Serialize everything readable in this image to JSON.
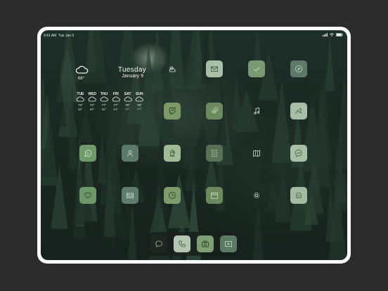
{
  "status_bar": {
    "time": "9:41 AM",
    "date": "Tue Jan 9"
  },
  "weather": {
    "icon": "cloud-icon",
    "current_temp": "68°",
    "day": "Tuesday",
    "date": "January 9",
    "forecast": [
      {
        "day": "TUE",
        "hi": "73°",
        "lo": "68°"
      },
      {
        "day": "WED",
        "hi": "72°",
        "lo": "69°"
      },
      {
        "day": "THU",
        "hi": "77°",
        "lo": "66°"
      },
      {
        "day": "FRI",
        "hi": "77°",
        "lo": "64°"
      },
      {
        "day": "SAT",
        "hi": "78°",
        "lo": "77°"
      },
      {
        "day": "SUN",
        "hi": "78°",
        "lo": "77°"
      }
    ]
  },
  "apps": [
    {
      "icon": "weather-icon",
      "color": "transparent"
    },
    {
      "icon": "mail-icon",
      "color": "#a9bfa7"
    },
    {
      "icon": "checkmark-icon",
      "color": "#7a9a74"
    },
    {
      "icon": "compass-icon",
      "color": "#5f7a68"
    },
    {
      "icon": "twitch-icon",
      "color": "#7a9a66"
    },
    {
      "icon": "paperclip-icon",
      "color": "#6b8a5e"
    },
    {
      "icon": "music-note-icon",
      "color": "transparent"
    },
    {
      "icon": "photos-icon",
      "color": "#a8bea6"
    },
    {
      "icon": "whatsapp-icon",
      "color": "#6f9a6a"
    },
    {
      "icon": "contacts-icon",
      "color": "#5c7a6a"
    },
    {
      "icon": "among-us-icon",
      "color": "#9fbb98"
    },
    {
      "icon": "notes-icon",
      "color": "#587055"
    },
    {
      "icon": "maps-icon",
      "color": "transparent"
    },
    {
      "icon": "messenger-icon",
      "color": "#a9bfa6"
    },
    {
      "icon": "heart-icon",
      "color": "#6d9868"
    },
    {
      "icon": "wallet-icon",
      "color": "#5f7d6e"
    },
    {
      "icon": "clock-icon",
      "color": "#7e9b6a"
    },
    {
      "icon": "calendar-icon",
      "color": "#6b8a5b"
    },
    {
      "icon": "settings-gear-icon",
      "color": "transparent"
    },
    {
      "icon": "discord-icon",
      "color": "#a3baa0"
    }
  ],
  "dock": [
    {
      "icon": "messages-icon",
      "color": "#1f2622"
    },
    {
      "icon": "phone-icon",
      "color": "#b4c6b0"
    },
    {
      "icon": "camera-icon",
      "color": "#7e9e74"
    },
    {
      "icon": "video-player-icon",
      "color": "#5b7a63"
    }
  ]
}
